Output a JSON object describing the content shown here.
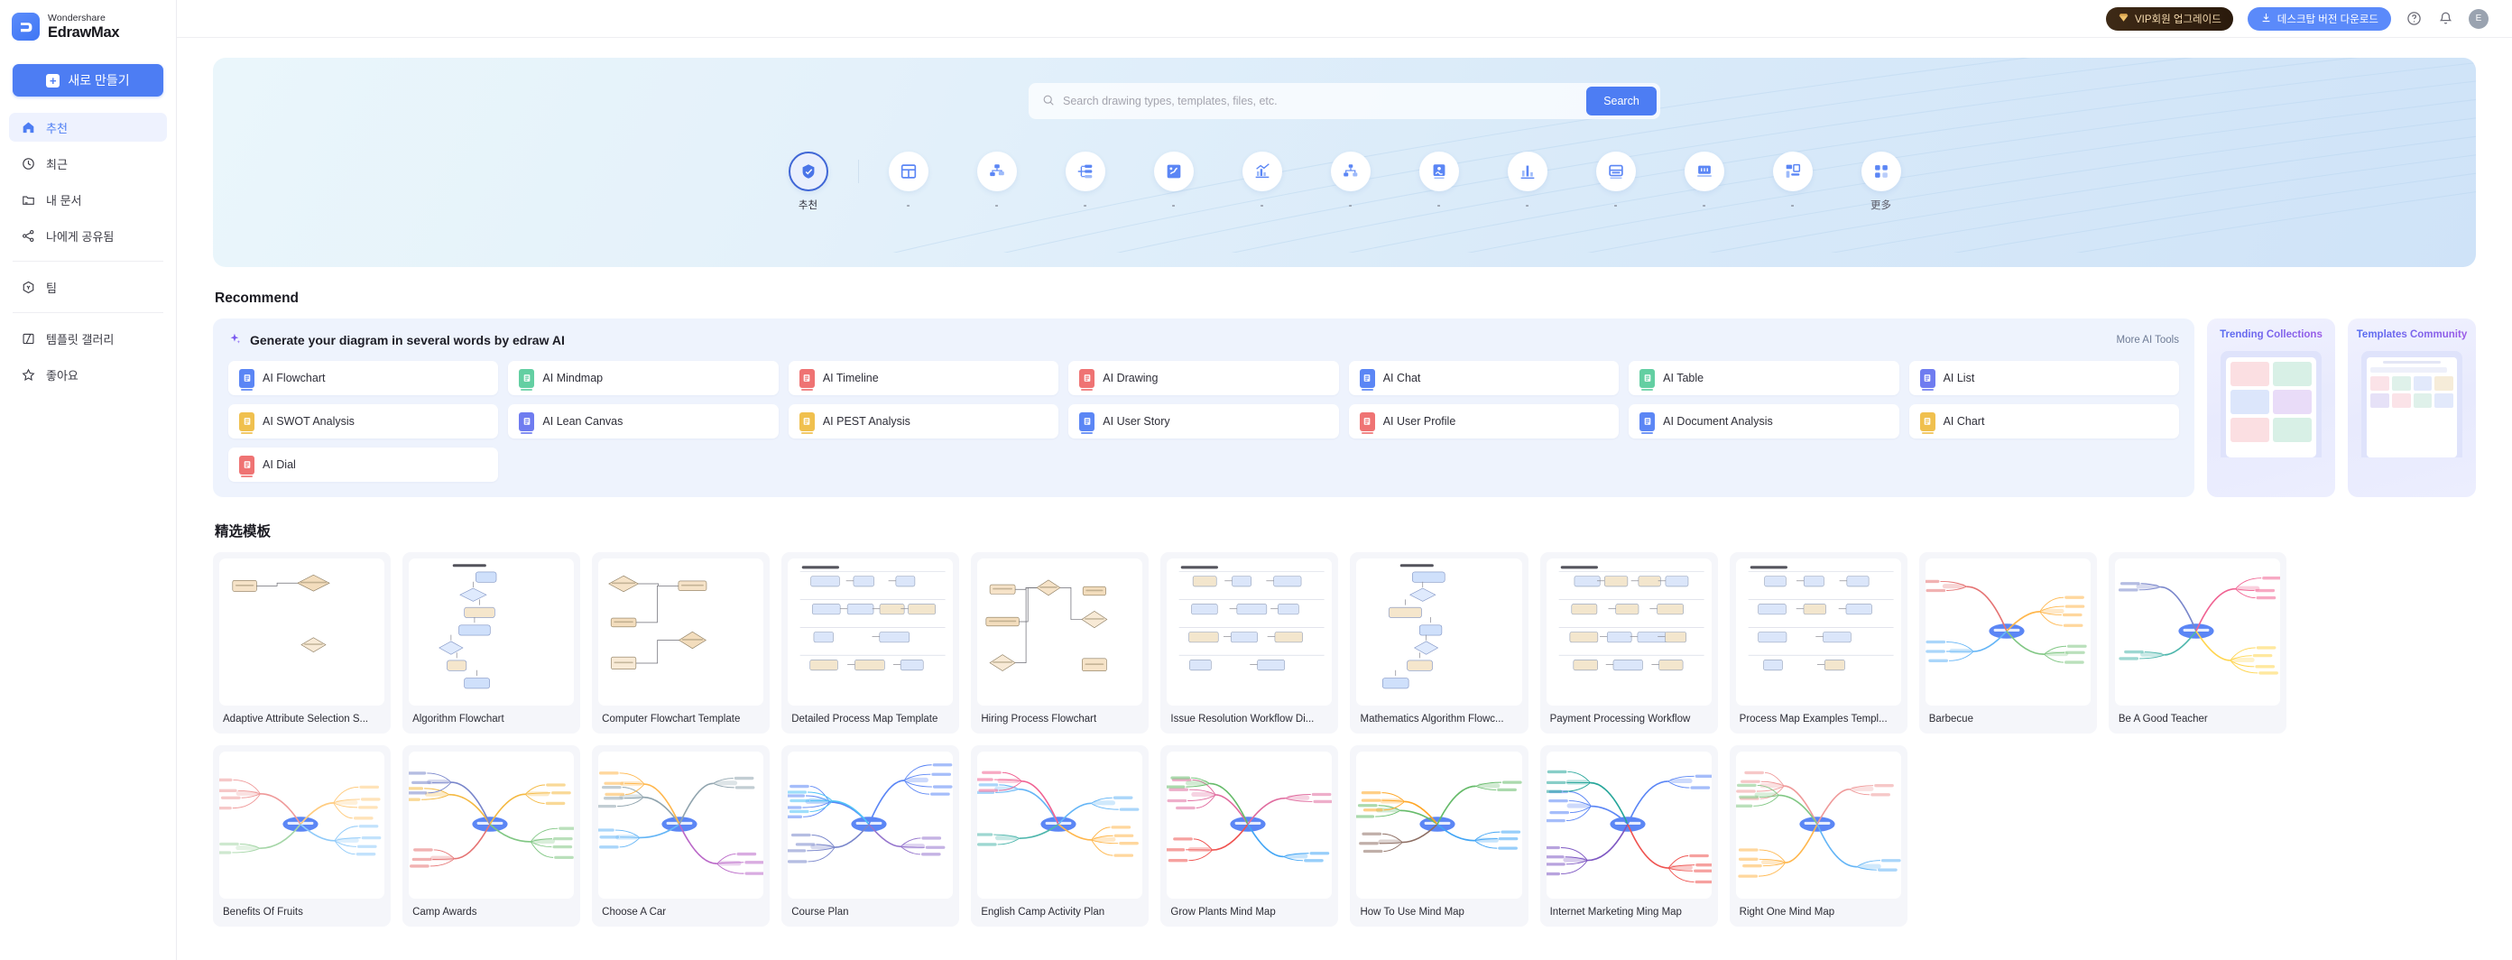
{
  "brand": {
    "top": "Wondershare",
    "bottom": "EdrawMax",
    "logo_icon": "edraw-logo-icon"
  },
  "sidebar": {
    "new_button": {
      "label": "새로 만들기",
      "icon": "plus-icon"
    },
    "items": [
      {
        "label": "추천",
        "icon": "home-icon",
        "active": true
      },
      {
        "label": "최근",
        "icon": "clock-icon",
        "active": false
      },
      {
        "label": "내 문서",
        "icon": "folder-icon",
        "active": false
      },
      {
        "label": "나에게 공유됨",
        "icon": "share-icon",
        "active": false
      },
      {
        "label": "팀",
        "icon": "team-hex-icon",
        "active": false
      },
      {
        "label": "템플릿 갤러리",
        "icon": "gallery-icon",
        "active": false
      },
      {
        "label": "좋아요",
        "icon": "star-icon",
        "active": false
      }
    ]
  },
  "topbar": {
    "vip_button": {
      "label": "VIP회원 업그레이드",
      "icon": "diamond-icon"
    },
    "download_button": {
      "label": "데스크탑 버전 다운로드",
      "icon": "download-icon"
    },
    "help_icon": "help-circle-icon",
    "bell_icon": "bell-icon",
    "avatar": {
      "initial": "E",
      "name": "avatar"
    }
  },
  "hero": {
    "search": {
      "placeholder": "Search drawing types, templates, files, etc.",
      "value": "",
      "icon": "search-icon",
      "button_label": "Search"
    },
    "categories": [
      {
        "label": "추천",
        "icon": "recommend-badge-icon",
        "selected": true
      },
      {
        "label": "-",
        "icon": "grid-window-icon",
        "selected": false
      },
      {
        "label": "-",
        "icon": "network-nodes-icon",
        "selected": false
      },
      {
        "label": "-",
        "icon": "tree-list-icon",
        "selected": false
      },
      {
        "label": "-",
        "icon": "map-pin-icon",
        "selected": false
      },
      {
        "label": "-",
        "icon": "trend-chart-icon",
        "selected": false
      },
      {
        "label": "-",
        "icon": "org-chart-icon",
        "selected": false
      },
      {
        "label": "-",
        "icon": "image-frame-icon",
        "selected": false
      },
      {
        "label": "-",
        "icon": "bar-chart-icon",
        "selected": false
      },
      {
        "label": "-",
        "icon": "card-layout-icon",
        "selected": false
      },
      {
        "label": "-",
        "icon": "presentation-icon",
        "selected": false
      },
      {
        "label": "-",
        "icon": "wireframe-icon",
        "selected": false
      },
      {
        "label": "更多",
        "icon": "more-squares-icon",
        "selected": false
      }
    ]
  },
  "recommend": {
    "section_title": "Recommend",
    "ai_panel": {
      "title": "Generate your diagram in several words by edraw AI",
      "sparkle_icon": "sparkle-icon",
      "more_link": "More AI Tools",
      "tools": [
        {
          "label": "AI Flowchart",
          "color": "#5b86f5"
        },
        {
          "label": "AI Mindmap",
          "color": "#63cfa2"
        },
        {
          "label": "AI Timeline",
          "color": "#ef7373"
        },
        {
          "label": "AI Drawing",
          "color": "#ef7373"
        },
        {
          "label": "AI Chat",
          "color": "#5b86f5"
        },
        {
          "label": "AI Table",
          "color": "#63cfa2"
        },
        {
          "label": "AI List",
          "color": "#6f7cf0"
        },
        {
          "label": "AI SWOT Analysis",
          "color": "#f0c04e"
        },
        {
          "label": "AI Lean Canvas",
          "color": "#6f7cf0"
        },
        {
          "label": "AI PEST Analysis",
          "color": "#f0c04e"
        },
        {
          "label": "AI User Story",
          "color": "#5b86f5"
        },
        {
          "label": "AI User Profile",
          "color": "#ef7373"
        },
        {
          "label": "AI Document Analysis",
          "color": "#5b86f5"
        },
        {
          "label": "AI Chart",
          "color": "#f0c04e"
        },
        {
          "label": "AI Dial",
          "color": "#ef7373"
        }
      ]
    },
    "promos": [
      {
        "title": "Trending Collections"
      },
      {
        "title": "Templates Community"
      }
    ]
  },
  "templates": {
    "section_title": "精选模板",
    "row1": [
      {
        "name": "Adaptive Attribute Selection S...",
        "thumb": "flowchart-tan"
      },
      {
        "name": "Algorithm Flowchart",
        "thumb": "flowchart-blue-vertical"
      },
      {
        "name": "Computer Flowchart Template",
        "thumb": "flowchart-wide"
      },
      {
        "name": "Detailed Process Map Template",
        "thumb": "process-map"
      },
      {
        "name": "Hiring Process Flowchart",
        "thumb": "flowchart-green"
      },
      {
        "name": "Issue Resolution Workflow Di...",
        "thumb": "workflow-swim"
      },
      {
        "name": "Mathematics Algorithm Flowc...",
        "thumb": "flowchart-math"
      },
      {
        "name": "Payment Processing Workflow",
        "thumb": "workflow-payment"
      },
      {
        "name": "Process Map Examples Templ...",
        "thumb": "process-examples"
      },
      {
        "name": "Barbecue",
        "thumb": "mindmap-bbq"
      },
      {
        "name": "Be A Good Teacher",
        "thumb": "mindmap-teacher"
      }
    ],
    "row2": [
      {
        "name": "Benefits Of Fruits",
        "thumb": "mindmap-fruits"
      },
      {
        "name": "Camp Awards",
        "thumb": "mindmap-camp"
      },
      {
        "name": "Choose A Car",
        "thumb": "mindmap-car"
      },
      {
        "name": "Course Plan",
        "thumb": "mindmap-course"
      },
      {
        "name": "English Camp Activity Plan",
        "thumb": "mindmap-english"
      },
      {
        "name": "Grow Plants Mind Map",
        "thumb": "mindmap-plants"
      },
      {
        "name": "How To Use Mind Map",
        "thumb": "mindmap-howto"
      },
      {
        "name": "Internet Marketing Ming Map",
        "thumb": "mindmap-internet"
      },
      {
        "name": "Right One Mind Map",
        "thumb": "mindmap-right"
      }
    ]
  },
  "colors": {
    "accent": "#4d7df3",
    "sidebar_active_bg": "#eef2fe",
    "ai_panel_bg": "#eef3fd",
    "card_bg": "#f5f6fa",
    "vip_gold": "#f6dcb0"
  }
}
